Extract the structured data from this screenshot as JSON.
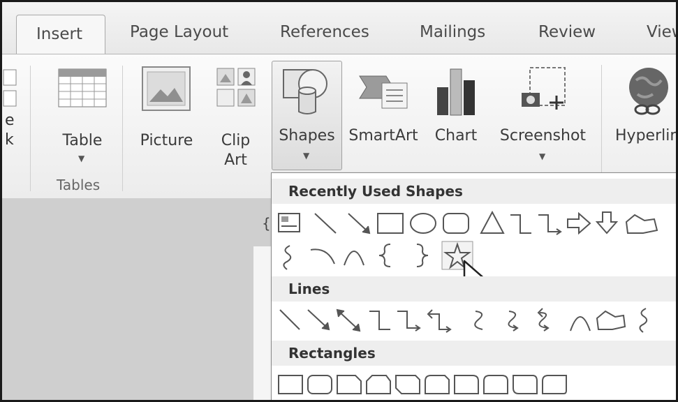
{
  "tabs": [
    {
      "label": "Insert",
      "active": true
    },
    {
      "label": "Page Layout"
    },
    {
      "label": "References"
    },
    {
      "label": "Mailings"
    },
    {
      "label": "Review"
    },
    {
      "label": "View"
    }
  ],
  "ribbon": {
    "left_partial_labels": [
      "e",
      "k"
    ],
    "table": {
      "label": "Table",
      "icon": "table-icon"
    },
    "tables_group_label": "Tables",
    "picture": {
      "label": "Picture",
      "icon": "picture-icon"
    },
    "clip_art": {
      "label_line1": "Clip",
      "label_line2": "Art",
      "icon": "clip-art-icon"
    },
    "shapes": {
      "label": "Shapes",
      "icon": "shapes-icon"
    },
    "smartart": {
      "label": "SmartArt",
      "icon": "smartart-icon"
    },
    "chart": {
      "label": "Chart",
      "icon": "chart-icon"
    },
    "screenshot": {
      "label": "Screenshot",
      "icon": "screenshot-icon"
    },
    "hyperlink": {
      "label": "Hyperlink",
      "icon": "hyperlink-globe-icon"
    }
  },
  "dropdown": {
    "sections": [
      {
        "title": "Recently Used Shapes"
      },
      {
        "title": "Lines"
      },
      {
        "title": "Rectangles"
      }
    ],
    "hovered_shape": "star-shape"
  },
  "colors": {
    "ribbon_bg": "#f3f3f3",
    "dropdown_header_bg": "#eeeeee",
    "shape_stroke": "#555555"
  }
}
